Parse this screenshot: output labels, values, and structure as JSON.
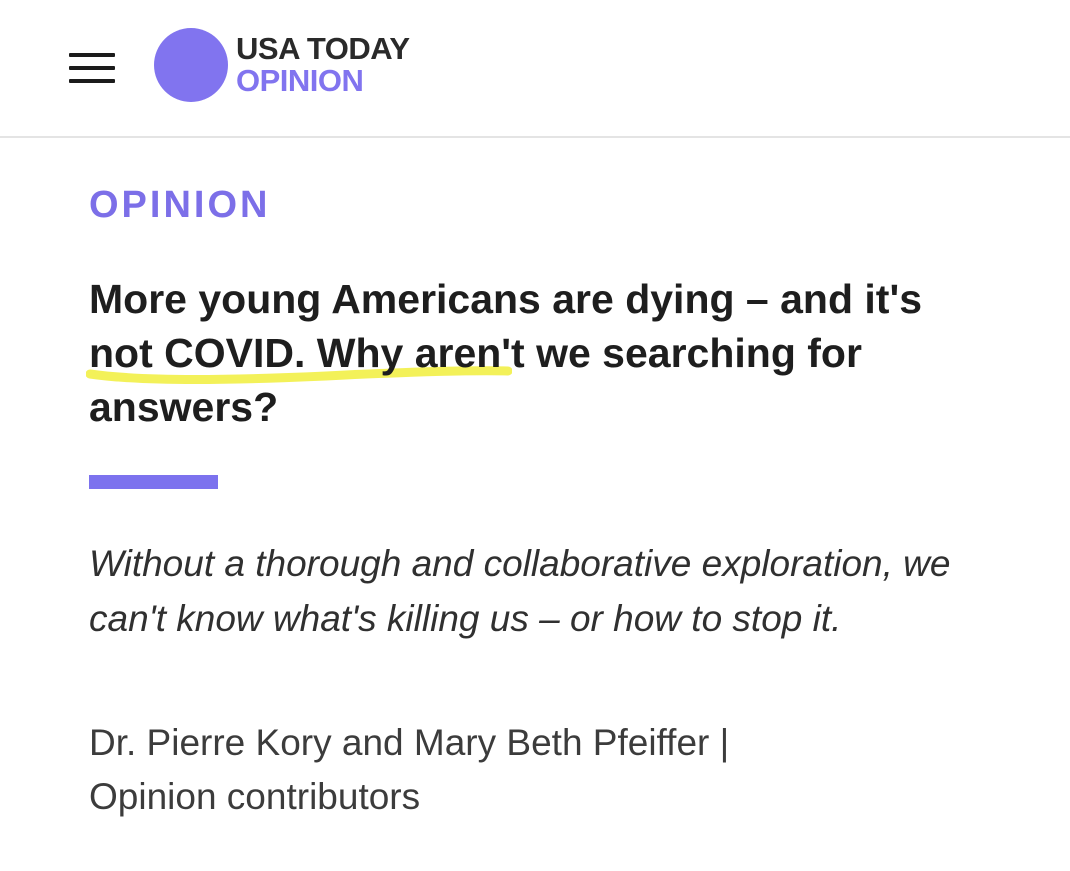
{
  "header": {
    "logo_line1": "USA TODAY",
    "logo_line2": "OPINION",
    "menu_icon": "hamburger-menu-icon"
  },
  "article": {
    "section_label": "OPINION",
    "headline": "More young Americans are dying – and it's not COVID. Why aren't we searching for answers?",
    "deck": "Without a thorough and collaborative exploration, we can't know what's killing us – or how to stop it.",
    "authors": "Dr. Pierre Kory and Mary Beth Pfeiffer",
    "separator": "|",
    "byline_role": "Opinion contributors"
  },
  "colors": {
    "brand": "#8174ef",
    "highlight": "#f2f047",
    "text": "#1e1e1e"
  }
}
